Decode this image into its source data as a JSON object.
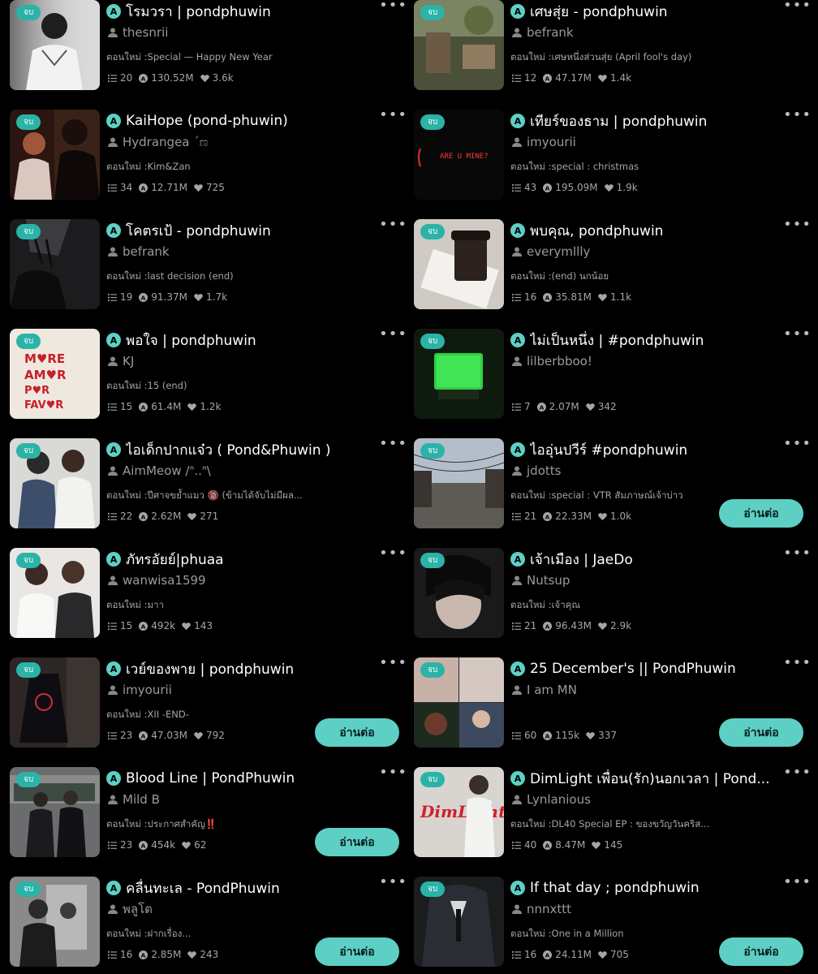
{
  "labels": {
    "badge": "จบ",
    "read_more": "อ่านต่อ",
    "more": "•••"
  },
  "colors": {
    "accent": "#5ecfc4",
    "badge": "#2bb3a8",
    "background": "#000000",
    "muted": "#9a9a9a"
  },
  "stories": [
    {
      "title": "โรมวรา | pondphuwin",
      "author": "thesnrii",
      "update": "ตอนใหม่ :Special — Happy New Year",
      "chapters": "20",
      "views": "130.52M",
      "likes": "3.6k",
      "read_button": false,
      "thumb": "bw-portrait"
    },
    {
      "title": "เศษสุ่ย - pondphuwin",
      "author": "befrank",
      "update": "ตอนใหม่ :เศษหนึ่งส่วนสุ่ย (April fool's day)",
      "chapters": "12",
      "views": "47.17M",
      "likes": "1.4k",
      "read_button": false,
      "thumb": "garden"
    },
    {
      "title": "KaiHope (pond-phuwin)",
      "author": "Hydrangea ´ಣ",
      "update": "ตอนใหม่ :Kim&Zan",
      "chapters": "34",
      "views": "12.71M",
      "likes": "725",
      "read_button": false,
      "thumb": "dark-couple"
    },
    {
      "title": "เทียร์ของธาม | pondphuwin",
      "author": "imyourii",
      "update": "ตอนใหม่ :special : christmas",
      "chapters": "43",
      "views": "195.09M",
      "likes": "1.9k",
      "read_button": false,
      "thumb": "neon"
    },
    {
      "title": "โคตรเป้ - pondphuwin",
      "author": "befrank",
      "update": "ตอนใหม่ :last decision (end)",
      "chapters": "19",
      "views": "91.37M",
      "likes": "1.7k",
      "read_button": false,
      "thumb": "shadow"
    },
    {
      "title": "พบคุณ, pondphuwin",
      "author": "everymllly",
      "update": "ตอนใหม่ :(end) นกน้อย",
      "chapters": "16",
      "views": "35.81M",
      "likes": "1.1k",
      "read_button": false,
      "thumb": "coffee"
    },
    {
      "title": "พอใจ | pondphuwin",
      "author": "KJ",
      "update": "ตอนใหม่ :15 (end)",
      "chapters": "15",
      "views": "61.4M",
      "likes": "1.2k",
      "read_button": false,
      "thumb": "amor"
    },
    {
      "title": "ไม่เป็นหนึ่ง | #pondphuwin",
      "author": "lilberbboo!",
      "update": "",
      "chapters": "7",
      "views": "2.07M",
      "likes": "342",
      "read_button": false,
      "thumb": "green-tv"
    },
    {
      "title": "ไอเด็กปากแจ๋ว ( Pond&Phuwin )",
      "author": "AimMeow /ᐢ..ᐢ\\",
      "update": "ตอนใหม่ :ปีศาจขย้ำแมว 🔞 (ข้ามได้จับไม่มีผล...",
      "chapters": "22",
      "views": "2.62M",
      "likes": "271",
      "read_button": false,
      "thumb": "two-boys"
    },
    {
      "title": "ไออุ่นปวีร์ #pondphuwin",
      "author": "jdotts",
      "update": "ตอนใหม่ :special : VTR สัมภาษณ์เจ้าบ่าว",
      "chapters": "21",
      "views": "22.33M",
      "likes": "1.0k",
      "read_button": true,
      "thumb": "street"
    },
    {
      "title": "ภัทรอัยย์|phuaa",
      "author": "wanwisa1599",
      "update": "ตอนใหม่ :มาา",
      "chapters": "15",
      "views": "492k",
      "likes": "143",
      "read_button": false,
      "thumb": "bright-pair"
    },
    {
      "title": "เจ้าเมือง | JaeDo",
      "author": "Nutsup",
      "update": "ตอนใหม่ :เจ้าคุณ",
      "chapters": "21",
      "views": "96.43M",
      "likes": "2.9k",
      "read_button": false,
      "thumb": "dark-hair"
    },
    {
      "title": "เวย์ของพาย | pondphuwin",
      "author": "imyourii",
      "update": "ตอนใหม่ :XII -END-",
      "chapters": "23",
      "views": "47.03M",
      "likes": "792",
      "read_button": true,
      "thumb": "sign"
    },
    {
      "title": "25 December's || PondPhuwin",
      "author": "I am MN",
      "update": "",
      "chapters": "60",
      "views": "115k",
      "likes": "337",
      "read_button": true,
      "thumb": "collage"
    },
    {
      "title": "Blood Line | PondPhuwin",
      "author": "Mild B",
      "update": "ตอนใหม่ :ประกาศสำคัญ‼️",
      "chapters": "23",
      "views": "454k",
      "likes": "62",
      "read_button": true,
      "thumb": "train"
    },
    {
      "title": "DimLight เพื่อน(รัก)นอกเวลา | Pond...",
      "author": "Lynlanious",
      "update": "ตอนใหม่ :DL40 Special EP : ของขวัญวันคริส...",
      "chapters": "40",
      "views": "8.47M",
      "likes": "145",
      "read_button": false,
      "thumb": "dimlight"
    },
    {
      "title": "คลื่นทะเล - PondPhuwin",
      "author": "พลูโต",
      "update": "ตอนใหม่ :ฝากเรื่อง...",
      "chapters": "16",
      "views": "2.85M",
      "likes": "243",
      "read_button": true,
      "thumb": "mirror"
    },
    {
      "title": "If that day ; pondphuwin",
      "author": "nnnxttt",
      "update": "ตอนใหม่ :One in a Million",
      "chapters": "16",
      "views": "24.11M",
      "likes": "705",
      "read_button": true,
      "thumb": "suit"
    }
  ]
}
